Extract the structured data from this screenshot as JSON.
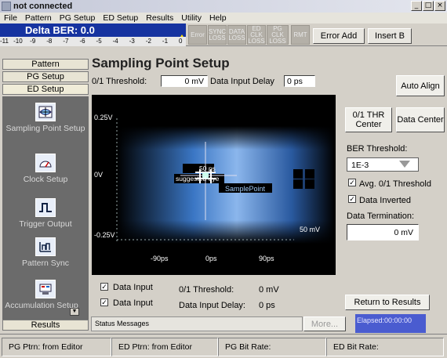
{
  "window": {
    "title": "not connected",
    "controls": [
      "_",
      "□",
      "×"
    ]
  },
  "menu": [
    "File",
    "Pattern",
    "PG Setup",
    "ED Setup",
    "Results",
    "Utility",
    "Help"
  ],
  "toolbar": {
    "ber_title": "Delta BER: 0.0",
    "ber_scale": [
      "-11",
      "-10",
      "-9",
      "-8",
      "-7",
      "-6",
      "-5",
      "-4",
      "-3",
      "-2",
      "-1",
      "0"
    ],
    "ber_level": 1.0,
    "alarms": [
      "Error",
      "SYNC LOSS",
      "DATA LOSS",
      "ED CLK LOSS",
      "PG CLK LOSS",
      "RMT"
    ],
    "error_add": "Error Add",
    "insert_b": "Insert B"
  },
  "nav": {
    "pattern": "Pattern",
    "pg_setup": "PG Setup",
    "ed_setup": "ED Setup",
    "items": [
      "Sampling Point Setup",
      "Clock Setup",
      "Trigger Output",
      "Pattern Sync",
      "Accumulation Setup"
    ],
    "results": "Results"
  },
  "page": {
    "title": "Sampling Point Setup",
    "threshold_label": "0/1 Threshold:",
    "threshold_value": "0 mV",
    "delay_label": "Data  Input Delay",
    "delay_value": "0 ps",
    "auto_align": "Auto Align"
  },
  "plot": {
    "y_labels": [
      "0.25V",
      "0V",
      "-0.25V"
    ],
    "x_labels": [
      "-90ps",
      "0ps",
      "90ps"
    ],
    "width_label": "50 ps",
    "eye_label": "suggested eye",
    "sample_label": "SamplePoint",
    "height_label": "50 mV"
  },
  "side": {
    "thr_center": "0/1 THR Center",
    "data_center": "Data Center",
    "ber_threshold_label": "BER Threshold:",
    "ber_threshold_value": "1E-3",
    "avg_label": "Avg. 0/1 Threshold",
    "inverted_label": "Data Inverted",
    "termination_label": "Data Termination:",
    "termination_value": "0 mV",
    "return_results": "Return to Results"
  },
  "legend": {
    "input1": "Data Input",
    "input2": "Data Input",
    "threshold_label": "0/1 Threshold:",
    "threshold_value": "0 mV",
    "delay_label": "Data Input Delay:",
    "delay_value": "0 ps"
  },
  "status": {
    "messages": "Status Messages",
    "more": "More...",
    "elapsed": "Elapsed:00:00:00"
  },
  "statusbar": [
    "PG Ptrn: from Editor",
    "ED Ptrn: from Editor",
    "PG Bit Rate:",
    "ED Bit Rate:"
  ]
}
